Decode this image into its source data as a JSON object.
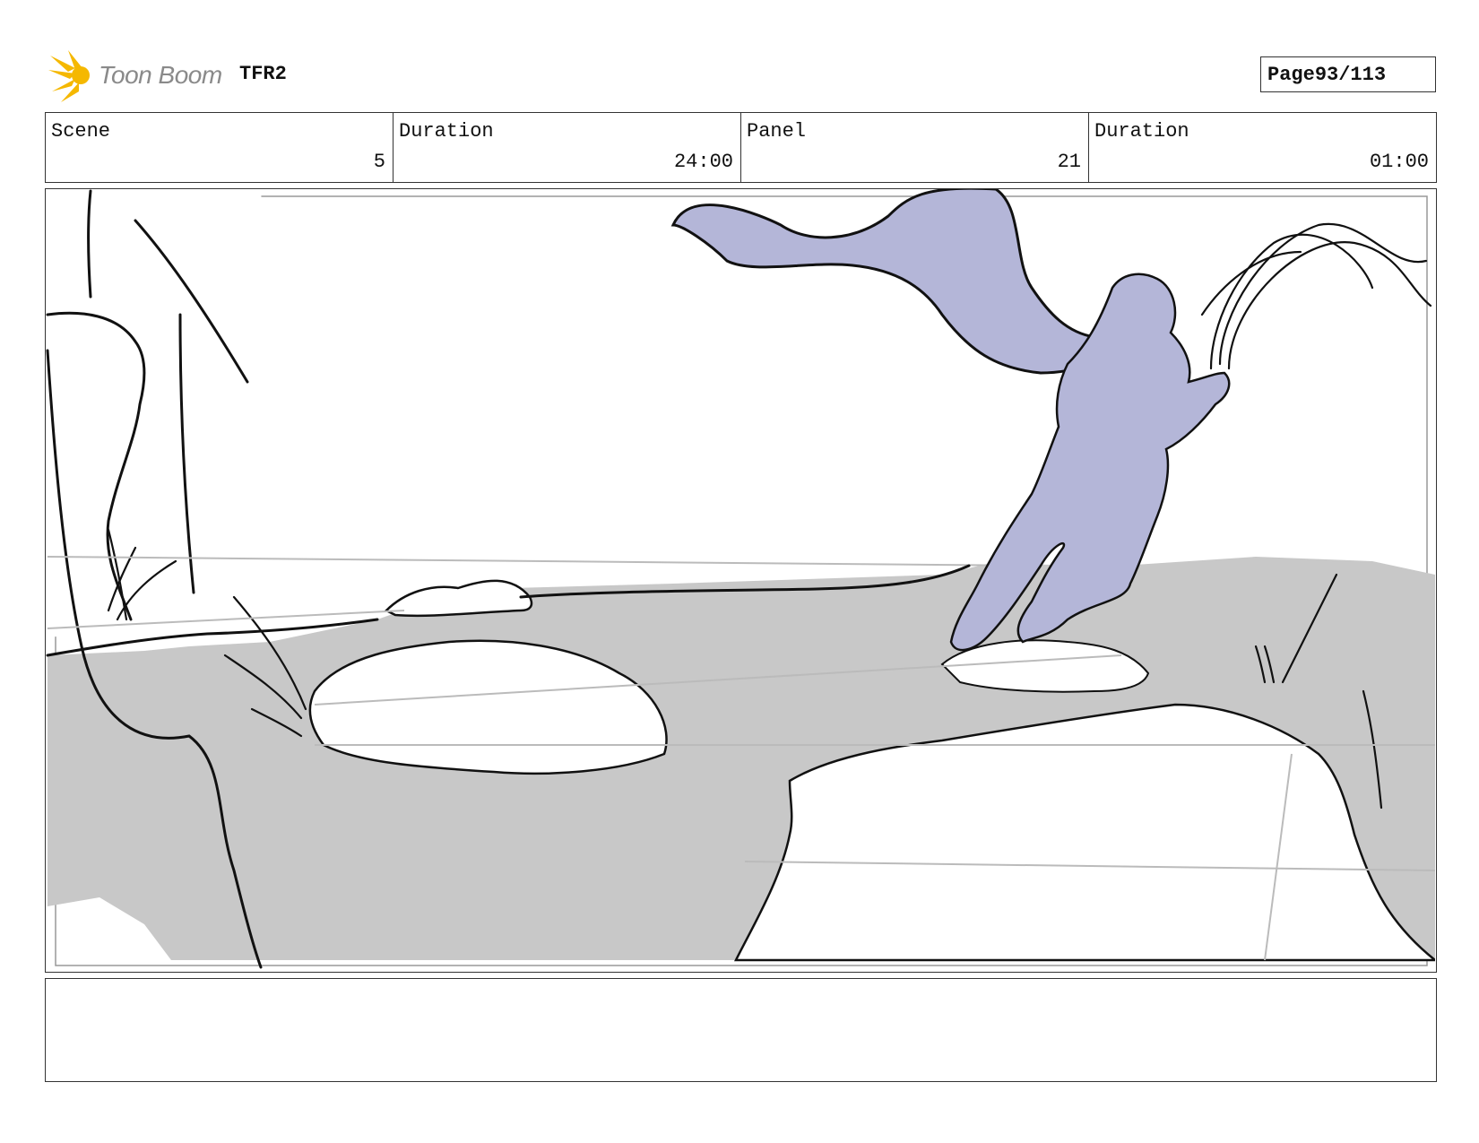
{
  "header": {
    "logo_text": "Toon Boom",
    "project_name": "TFR2",
    "page_label": "Page",
    "page_value": "93/113"
  },
  "info": {
    "scene_label": "Scene",
    "scene_value": "5",
    "scene_duration_label": "Duration",
    "scene_duration_value": "24:00",
    "panel_label": "Panel",
    "panel_value": "21",
    "panel_duration_label": "Duration",
    "panel_duration_value": "01:00"
  },
  "colors": {
    "logo_accent": "#f5b800",
    "ground_fill": "#c8c8c8",
    "character_fill": "#b4b6d8",
    "line": "#111111"
  },
  "notes": {
    "text": ""
  }
}
